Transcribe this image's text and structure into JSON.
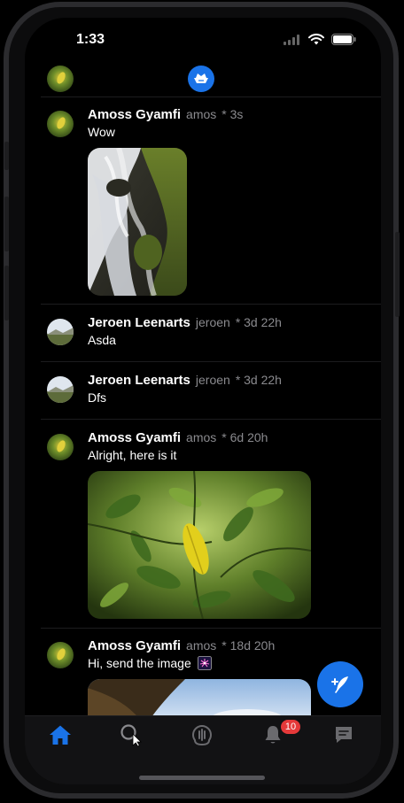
{
  "status": {
    "time": "1:33"
  },
  "nav": {},
  "posts": [
    {
      "name": "Amoss Gyamfi",
      "handle": "amos",
      "time": "* 3s",
      "text": "Wow",
      "has_image": true
    },
    {
      "name": "Jeroen Leenarts",
      "handle": "jeroen",
      "time": "* 3d 22h",
      "text": "Asda",
      "has_image": false
    },
    {
      "name": "Jeroen Leenarts",
      "handle": "jeroen",
      "time": "* 3d 22h",
      "text": "Dfs",
      "has_image": false
    },
    {
      "name": "Amoss Gyamfi",
      "handle": "amos",
      "time": "* 6d 20h",
      "text": "Alright, here is it",
      "has_image": true
    },
    {
      "name": "Amoss Gyamfi",
      "handle": "amos",
      "time": "* 18d 20h",
      "text": "Hi, send the image",
      "has_image": true
    }
  ],
  "tabs": [
    {
      "name": "home",
      "active": true
    },
    {
      "name": "search",
      "active": false
    },
    {
      "name": "spaces",
      "active": false
    },
    {
      "name": "notifications",
      "active": false,
      "badge": "10"
    },
    {
      "name": "messages",
      "active": false
    }
  ],
  "colors": {
    "accent": "#1a73e8",
    "badge": "#e5393a",
    "muted": "#8a8a8e"
  }
}
